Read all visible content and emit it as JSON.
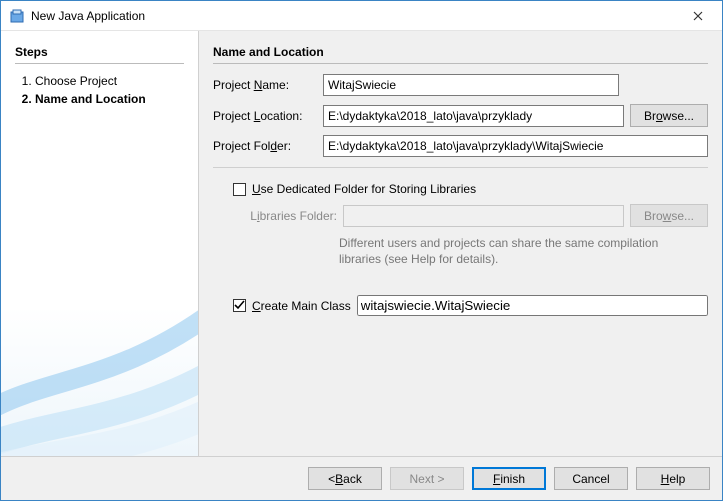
{
  "window": {
    "title": "New Java Application"
  },
  "sidebar": {
    "heading": "Steps",
    "steps": [
      {
        "label": "Choose Project",
        "current": false
      },
      {
        "label": "Name and Location",
        "current": true
      }
    ]
  },
  "main": {
    "heading": "Name and Location",
    "project_name": {
      "label_pre": "Project ",
      "label_u": "N",
      "label_post": "ame:",
      "value": "WitajSwiecie"
    },
    "project_location": {
      "label_pre": "Project ",
      "label_u": "L",
      "label_post": "ocation:",
      "value": "E:\\dydaktyka\\2018_lato\\java\\przyklady",
      "browse_pre": "Br",
      "browse_u": "o",
      "browse_post": "wse..."
    },
    "project_folder": {
      "label_pre": "Project Fol",
      "label_u": "d",
      "label_post": "er:",
      "value": "E:\\dydaktyka\\2018_lato\\java\\przyklady\\WitajSwiecie"
    },
    "dedicated": {
      "checked": false,
      "label_pre": "",
      "label_u": "U",
      "label_post": "se Dedicated Folder for Storing Libraries",
      "lib_label_pre": "L",
      "lib_label_u": "i",
      "lib_label_post": "braries Folder:",
      "lib_value": "",
      "browse_pre": "Bro",
      "browse_u": "w",
      "browse_post": "se...",
      "help": "Different users and projects can share the same compilation libraries (see Help for details)."
    },
    "main_class": {
      "checked": true,
      "label_pre": "",
      "label_u": "C",
      "label_post": "reate Main Class",
      "value": "witajswiecie.WitajSwiecie"
    }
  },
  "footer": {
    "back_pre": "< ",
    "back_u": "B",
    "back_post": "ack",
    "next": "Next >",
    "finish_pre": "",
    "finish_u": "F",
    "finish_post": "inish",
    "cancel": "Cancel",
    "help_pre": "",
    "help_u": "H",
    "help_post": "elp"
  }
}
